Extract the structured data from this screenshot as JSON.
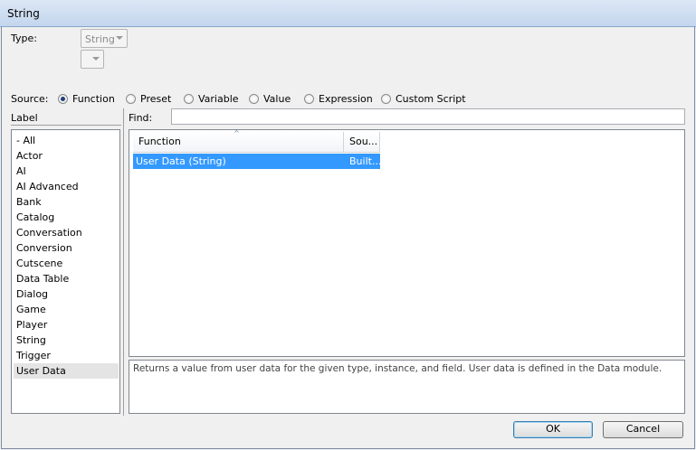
{
  "window": {
    "title": "String"
  },
  "type_section": {
    "label": "Type:",
    "type_value": "String",
    "secondary_value": ""
  },
  "source": {
    "label": "Source:",
    "options": [
      {
        "label": "Function",
        "selected": true
      },
      {
        "label": "Preset",
        "selected": false
      },
      {
        "label": "Variable",
        "selected": false
      },
      {
        "label": "Value",
        "selected": false
      },
      {
        "label": "Expression",
        "selected": false
      },
      {
        "label": "Custom Script",
        "selected": false
      }
    ]
  },
  "label_panel": {
    "header": "Label",
    "items": [
      "- All",
      "Actor",
      "AI",
      "AI Advanced",
      "Bank",
      "Catalog",
      "Conversation",
      "Conversion",
      "Cutscene",
      "Data Table",
      "Dialog",
      "Game",
      "Player",
      "String",
      "Trigger",
      "User Data"
    ],
    "selected_index": 15
  },
  "find": {
    "label": "Find:",
    "value": ""
  },
  "function_table": {
    "columns": [
      "Function",
      "Sou..."
    ],
    "rows": [
      {
        "function": "User Data (String)",
        "source": "Built..."
      }
    ]
  },
  "description": "Returns a value from user data for the given type, instance, and field. User data is defined in the Data module.",
  "buttons": {
    "ok": "OK",
    "cancel": "Cancel"
  },
  "colors": {
    "selection": "#3399ff",
    "title_bar": "#c3d6ee"
  }
}
